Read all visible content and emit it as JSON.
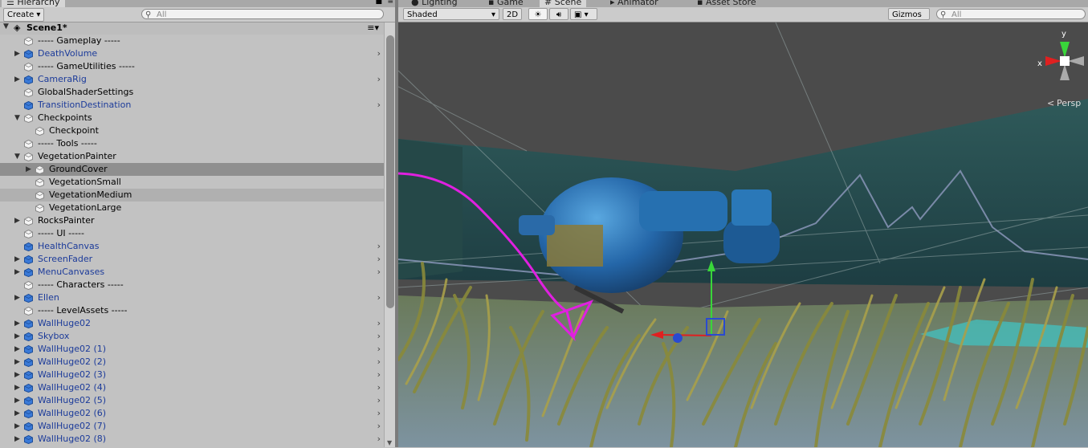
{
  "hierarchy": {
    "tab_label": "Hierarchy",
    "create_label": "Create",
    "search_placeholder": "All",
    "scene_name": "Scene1*",
    "rows": [
      {
        "label": "----- Gameplay -----",
        "blue": false,
        "indent": 0,
        "arrow": "",
        "chev": false
      },
      {
        "label": "DeathVolume",
        "blue": true,
        "indent": 0,
        "arrow": "right",
        "chev": true
      },
      {
        "label": "----- GameUtilities -----",
        "blue": false,
        "indent": 0,
        "arrow": "",
        "chev": false
      },
      {
        "label": "CameraRig",
        "blue": true,
        "indent": 0,
        "arrow": "right",
        "chev": true
      },
      {
        "label": "GlobalShaderSettings",
        "blue": false,
        "indent": 0,
        "arrow": "",
        "chev": false
      },
      {
        "label": "TransitionDestination",
        "blue": true,
        "indent": 0,
        "arrow": "",
        "chev": true
      },
      {
        "label": "Checkpoints",
        "blue": false,
        "indent": 0,
        "arrow": "down",
        "chev": false
      },
      {
        "label": "Checkpoint",
        "blue": false,
        "indent": 1,
        "arrow": "",
        "chev": false
      },
      {
        "label": "----- Tools -----",
        "blue": false,
        "indent": 0,
        "arrow": "",
        "chev": false
      },
      {
        "label": "VegetationPainter",
        "blue": false,
        "indent": 0,
        "arrow": "down",
        "chev": false
      },
      {
        "label": "GroundCover",
        "blue": false,
        "indent": 1,
        "arrow": "right",
        "chev": false,
        "selected": true
      },
      {
        "label": "VegetationSmall",
        "blue": false,
        "indent": 1,
        "arrow": "",
        "chev": false
      },
      {
        "label": "VegetationMedium",
        "blue": false,
        "indent": 1,
        "arrow": "",
        "chev": false,
        "hover": true
      },
      {
        "label": "VegetationLarge",
        "blue": false,
        "indent": 1,
        "arrow": "",
        "chev": false
      },
      {
        "label": "RocksPainter",
        "blue": false,
        "indent": 0,
        "arrow": "right",
        "chev": false
      },
      {
        "label": "----- UI -----",
        "blue": false,
        "indent": 0,
        "arrow": "",
        "chev": false
      },
      {
        "label": "HealthCanvas",
        "blue": true,
        "indent": 0,
        "arrow": "",
        "chev": true
      },
      {
        "label": "ScreenFader",
        "blue": true,
        "indent": 0,
        "arrow": "right",
        "chev": true
      },
      {
        "label": "MenuCanvases",
        "blue": true,
        "indent": 0,
        "arrow": "right",
        "chev": true
      },
      {
        "label": "----- Characters -----",
        "blue": false,
        "indent": 0,
        "arrow": "",
        "chev": false
      },
      {
        "label": "Ellen",
        "blue": true,
        "indent": 0,
        "arrow": "right",
        "chev": true
      },
      {
        "label": "----- LevelAssets -----",
        "blue": false,
        "indent": 0,
        "arrow": "",
        "chev": false
      },
      {
        "label": "WallHuge02",
        "blue": true,
        "indent": 0,
        "arrow": "right",
        "chev": true
      },
      {
        "label": "Skybox",
        "blue": true,
        "indent": 0,
        "arrow": "right",
        "chev": true
      },
      {
        "label": "WallHuge02 (1)",
        "blue": true,
        "indent": 0,
        "arrow": "right",
        "chev": true
      },
      {
        "label": "WallHuge02 (2)",
        "blue": true,
        "indent": 0,
        "arrow": "right",
        "chev": true
      },
      {
        "label": "WallHuge02 (3)",
        "blue": true,
        "indent": 0,
        "arrow": "right",
        "chev": true
      },
      {
        "label": "WallHuge02 (4)",
        "blue": true,
        "indent": 0,
        "arrow": "right",
        "chev": true
      },
      {
        "label": "WallHuge02 (5)",
        "blue": true,
        "indent": 0,
        "arrow": "right",
        "chev": true
      },
      {
        "label": "WallHuge02 (6)",
        "blue": true,
        "indent": 0,
        "arrow": "right",
        "chev": true
      },
      {
        "label": "WallHuge02 (7)",
        "blue": true,
        "indent": 0,
        "arrow": "right",
        "chev": true
      },
      {
        "label": "WallHuge02 (8)",
        "blue": true,
        "indent": 0,
        "arrow": "right",
        "chev": true
      }
    ]
  },
  "scene_view": {
    "tabs": [
      "Lighting",
      "Game",
      "Scene",
      "Animator",
      "Asset Store"
    ],
    "active_tab": "Scene",
    "shading_mode": "Shaded",
    "mode_2d": "2D",
    "gizmos_label": "Gizmos",
    "search_placeholder": "All",
    "persp_label": "Persp",
    "axis_x": "x",
    "axis_y": "y"
  },
  "colors": {
    "selection": "#8f8f8f",
    "prefab_blue": "#1c3b9a",
    "gizmo_green": "#39d63a",
    "gizmo_red": "#e02020",
    "annotation_magenta": "#e020e0"
  }
}
